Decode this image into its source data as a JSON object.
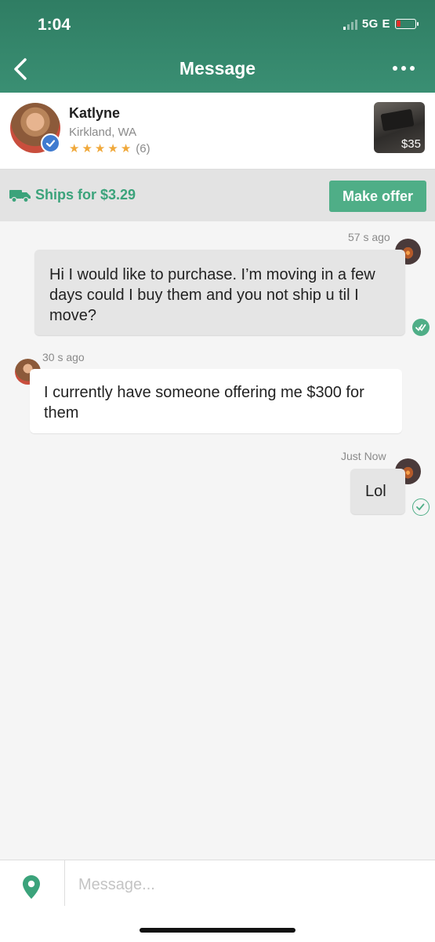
{
  "status": {
    "time": "1:04",
    "network": "5G E"
  },
  "header": {
    "title": "Message",
    "back_icon": "chevron-left-icon",
    "more_icon": "more-horizontal-icon"
  },
  "seller": {
    "name": "Katlyne",
    "location": "Kirkland, WA",
    "rating": 5,
    "rating_count": "(6)",
    "verified": true
  },
  "item": {
    "price": "$35"
  },
  "shipping": {
    "text": "Ships for $3.29",
    "icon": "truck-icon",
    "offer_button": "Make offer"
  },
  "messages": [
    {
      "from": "me",
      "time": "57 s ago",
      "text": "Hi I would like to purchase. I’m moving in a few days could I buy them and you not ship u til I move?",
      "status": "read"
    },
    {
      "from": "Katlyne",
      "time": "30 s ago",
      "text": "I currently have someone offering me $300 for them"
    },
    {
      "from": "me",
      "time": "Just Now",
      "text": "Lol",
      "status": "sent"
    }
  ],
  "composer": {
    "placeholder": "Message...",
    "location_icon": "location-pin-icon"
  },
  "colors": {
    "header": "#2f7d63",
    "accent": "#4fae87",
    "star": "#f0a83a",
    "battery_low": "#e0302b"
  }
}
